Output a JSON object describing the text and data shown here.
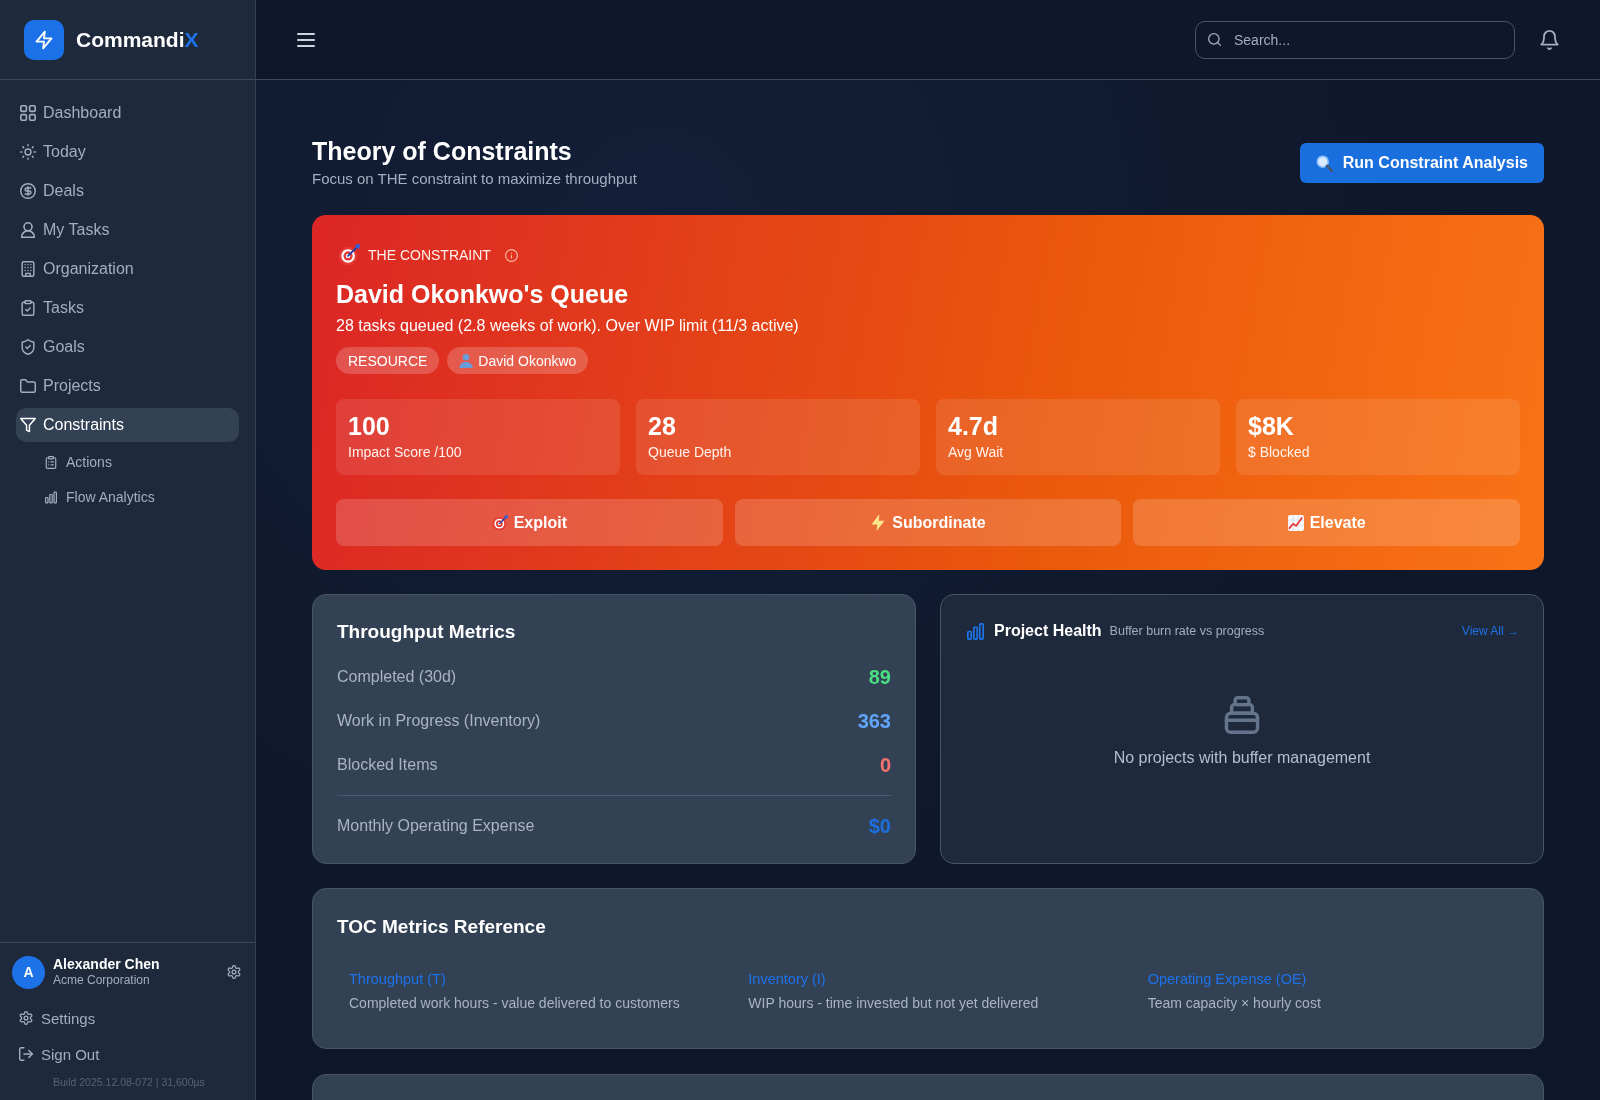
{
  "sidebar": {
    "brand": {
      "text": "Commandi",
      "accent": "X"
    },
    "nav": [
      {
        "label": "Dashboard",
        "selected": false
      },
      {
        "label": "Today",
        "selected": false
      },
      {
        "label": "Deals",
        "selected": false
      },
      {
        "label": "My Tasks",
        "selected": false
      },
      {
        "label": "Organization",
        "selected": false
      },
      {
        "label": "Tasks",
        "selected": false
      },
      {
        "label": "Goals",
        "selected": false
      },
      {
        "label": "Projects",
        "selected": false
      },
      {
        "label": "Constraints",
        "selected": true,
        "children": [
          {
            "label": "Actions",
            "selected": false
          },
          {
            "label": "Flow Analytics",
            "selected": false
          }
        ]
      }
    ],
    "user": {
      "initial": "A",
      "name": "Alexander Chen",
      "organization": "Acme Corporation"
    },
    "links": [
      {
        "label": "Settings"
      },
      {
        "label": "Sign Out"
      }
    ],
    "build": "Build 2025.12.08-072 | 31,600µs"
  },
  "topbar": {
    "search": {
      "placeholder": "Search..."
    }
  },
  "page": {
    "title": "Theory of Constraints",
    "subtitle": "Focus on THE constraint to maximize throughput",
    "action": "Run Constraint Analysis"
  },
  "constraint": {
    "eyebrow": "THE CONSTRAINT",
    "title": "David Okonkwo's Queue",
    "description": "28 tasks queued (2.8 weeks of work). Over WIP limit (11/3 active)",
    "tags": [
      {
        "kind": "type",
        "label": "RESOURCE"
      },
      {
        "kind": "person",
        "label": "David Okonkwo"
      }
    ],
    "stats": [
      {
        "value": "100",
        "label": "Impact Score /100"
      },
      {
        "value": "28",
        "label": "Queue Depth"
      },
      {
        "value": "4.7d",
        "label": "Avg Wait"
      },
      {
        "value": "$8K",
        "label": "$ Blocked"
      }
    ],
    "actions": [
      {
        "label": "Exploit"
      },
      {
        "label": "Subordinate"
      },
      {
        "label": "Elevate"
      }
    ]
  },
  "throughput": {
    "title": "Throughput Metrics",
    "rows": [
      {
        "kind": "metric",
        "label": "Completed (30d)",
        "value": "89",
        "color": "#4ade80"
      },
      {
        "kind": "metric",
        "label": "Work in Progress (Inventory)",
        "value": "363",
        "color": "#60a5fa"
      },
      {
        "kind": "metric",
        "label": "Blocked Items",
        "value": "0",
        "color": "#f87171"
      },
      {
        "kind": "total",
        "label": "Monthly Operating Expense",
        "value": "$0",
        "color": "#1d6fe0"
      }
    ]
  },
  "project_health": {
    "title": "Project Health",
    "subtitle": "Buffer burn rate vs progress",
    "link": "View All →",
    "empty_message": "No projects with buffer management"
  },
  "toc_reference": {
    "title": "TOC Metrics Reference",
    "items": [
      {
        "term": "Throughput (T)",
        "definition": "Completed work hours - value delivered to customers"
      },
      {
        "term": "Inventory (I)",
        "definition": "WIP hours - time invested but not yet delivered"
      },
      {
        "term": "Operating Expense (OE)",
        "definition": "Team capacity × hourly cost"
      }
    ]
  }
}
